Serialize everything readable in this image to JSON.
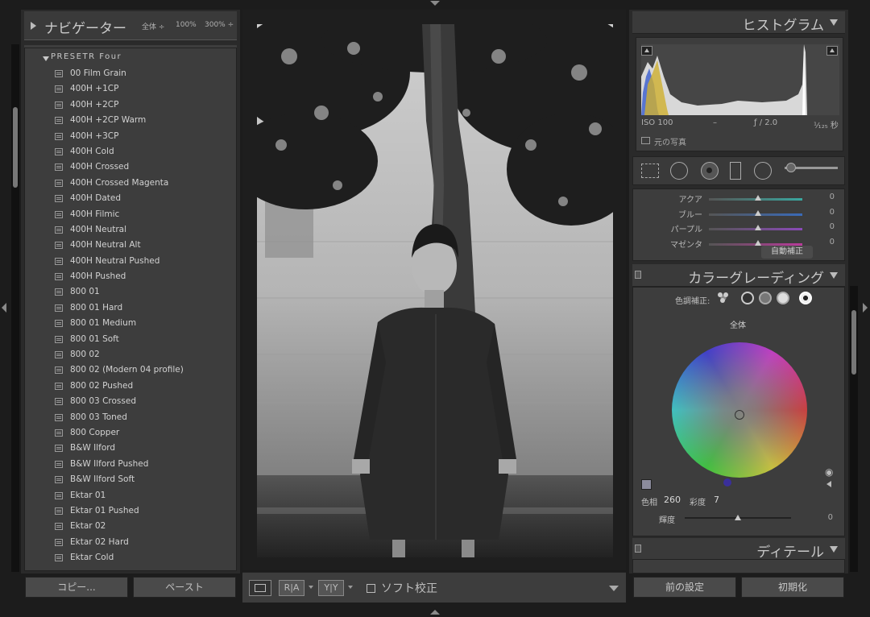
{
  "navigator": {
    "title": "ナビゲーター",
    "zoom_fit": "全体 ÷",
    "zoom_100": "100%",
    "zoom_300": "300% ÷"
  },
  "presets": {
    "folder": "PRESETR Four",
    "items": [
      "00 Film Grain",
      "400H +1CP",
      "400H +2CP",
      "400H +2CP Warm",
      "400H +3CP",
      "400H Cold",
      "400H Crossed",
      "400H Crossed Magenta",
      "400H Dated",
      "400H Filmic",
      "400H Neutral",
      "400H Neutral Alt",
      "400H Neutral Pushed",
      "400H Pushed",
      "800 01",
      "800 01 Hard",
      "800 01 Medium",
      "800 01 Soft",
      "800 02",
      "800 02 (Modern 04 profile)",
      "800 02 Pushed",
      "800 03 Crossed",
      "800 03 Toned",
      "800 Copper",
      "B&W Ilford",
      "B&W Ilford Pushed",
      "B&W Ilford Soft",
      "Ektar 01",
      "Ektar 01 Pushed",
      "Ektar 02",
      "Ektar 02 Hard",
      "Ektar Cold"
    ]
  },
  "left_buttons": {
    "copy": "コピー...",
    "paste": "ペースト"
  },
  "toolbar": {
    "view_ra": "R|A",
    "view_yy": "Y|Y",
    "soft_proof": "ソフト校正"
  },
  "histogram": {
    "title": "ヒストグラム",
    "iso": "ISO 100",
    "focal": "–",
    "aperture": "ƒ / 2.0",
    "shutter": "¹⁄₁₂₅ 秒",
    "original_photo": "元の写真"
  },
  "hsl": {
    "rows": [
      {
        "label": "アクア",
        "value": "0",
        "color": "#3aa8a0"
      },
      {
        "label": "ブルー",
        "value": "0",
        "color": "#3a6ab8"
      },
      {
        "label": "パープル",
        "value": "0",
        "color": "#8a4ab8"
      },
      {
        "label": "マゼンタ",
        "value": "0",
        "color": "#b83a9a"
      }
    ],
    "auto": "自動補正"
  },
  "color_grading": {
    "title": "カラーグレーディング",
    "adjust_label": "色調補正:",
    "scope": "全体",
    "hue_label": "色相",
    "hue_value": "260",
    "sat_label": "彩度",
    "sat_value": "7",
    "lum_label": "輝度",
    "lum_value": "0"
  },
  "detail": {
    "title": "ディテール"
  },
  "right_buttons": {
    "previous": "前の設定",
    "reset": "初期化"
  }
}
